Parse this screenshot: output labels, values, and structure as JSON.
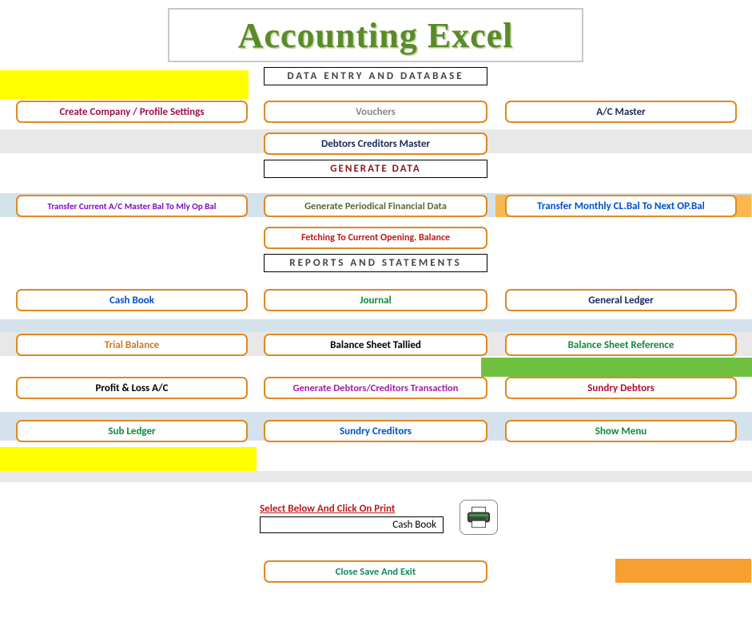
{
  "title": "Accounting Excel",
  "sections": {
    "data_entry": "DATA ENTRY AND DATABASE",
    "generate": "GENERATE  DATA",
    "reports": "REPORTS  AND  STATEMENTS"
  },
  "buttons": {
    "create_company": "Create Company / Profile Settings",
    "vouchers": "Vouchers",
    "ac_master": "A/C  Master",
    "debtors_creditors_master": "Debtors Creditors Master",
    "transfer_ac_master": "Transfer Current  A/C Master Bal  To Mly Op Bal",
    "generate_periodical": "Generate Periodical Financial Data",
    "transfer_monthly": "Transfer Monthly  CL.Bal To Next OP.Bal",
    "fetching_opening": "Fetching  To Current Opening. Balance",
    "cash_book": "Cash Book",
    "journal": "Journal",
    "general_ledger": "General Ledger",
    "trial_balance": "Trial Balance",
    "balance_sheet_tallied": "Balance Sheet Tallied",
    "balance_sheet_ref": "Balance Sheet Reference",
    "profit_loss": "Profit & Loss A/C",
    "gen_debtors_creditors": "Generate Debtors/Creditors Transaction",
    "sundry_debtors": "Sundry Debtors",
    "sub_ledger": "Sub Ledger",
    "sundry_creditors": "Sundry Creditors",
    "show_menu": "Show Menu",
    "close_save_exit": "Close Save And Exit"
  },
  "print": {
    "label": "Select Below And Click On Print",
    "selected": "Cash Book"
  }
}
